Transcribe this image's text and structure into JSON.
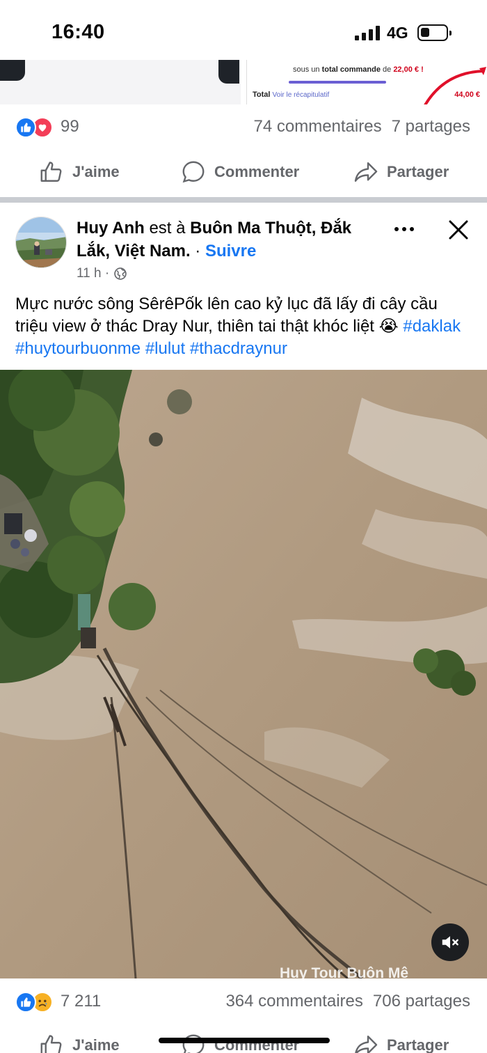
{
  "status_bar": {
    "time": "16:40",
    "network": "4G"
  },
  "previous_post": {
    "ad_line_prefix": "sous un ",
    "ad_line_bold": "total commande",
    "ad_line_mid": " de ",
    "ad_line_amount": "22,00 € !",
    "total_label": "Total",
    "total_link": "Voir le récapitulatif",
    "total_value": "44,00 €",
    "reaction_count": "99",
    "comments": "74 commentaires",
    "shares": "7 partages",
    "actions": {
      "like": "J'aime",
      "comment": "Commenter",
      "share": "Partager"
    }
  },
  "post": {
    "author": "Huy Anh",
    "is_at": " est à ",
    "location": "Buôn Ma Thuột, Đắk Lắk, Việt Nam.",
    "separator": " · ",
    "follow": "Suivre",
    "time": "11 h ·",
    "text": "Mực nước sông SêrêPốk lên cao kỷ lục đã lấy đi cây cầu triệu view ở thác Dray Nur, thiên tai thật khóc liệt ",
    "emoji": "😭",
    "hashtags": [
      "#daklak",
      "#huytourbuonme",
      "#lulut",
      "#thacdraynur"
    ],
    "video_watermark": "Huy Tour Buôn Mê",
    "reaction_count": "7 211",
    "comments": "364 commentaires",
    "shares": "706 partages",
    "actions": {
      "like": "J'aime",
      "comment": "Commenter",
      "share": "Partager"
    }
  },
  "colors": {
    "facebook_blue": "#1877f2",
    "love_red": "#f33e58",
    "sad_yellow": "#f7b125",
    "muted_text": "#65676b",
    "water": "#b39d84"
  },
  "icons": [
    "like-icon",
    "love-icon",
    "sad-icon",
    "comment-icon",
    "share-icon",
    "globe-icon",
    "more-icon",
    "close-icon",
    "mute-icon"
  ]
}
